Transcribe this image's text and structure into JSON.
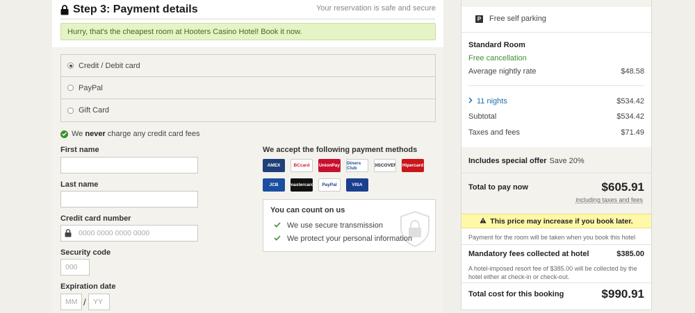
{
  "step": {
    "title": "Step 3: Payment details",
    "secure_note": "Your reservation is safe and secure"
  },
  "hurry_banner": "Hurry, that's the cheapest room at Hooters Casino Hotel! Book it now.",
  "payment_options": [
    {
      "label": "Credit / Debit card",
      "selected": true
    },
    {
      "label": "PayPal",
      "selected": false
    },
    {
      "label": "Gift Card",
      "selected": false
    }
  ],
  "fees_note": {
    "prefix": "We",
    "emphasis": "never",
    "suffix": "charge any credit card fees"
  },
  "form": {
    "first_name_label": "First name",
    "last_name_label": "Last name",
    "cc_label": "Credit card number",
    "cc_placeholder": "0000 0000 0000 0000",
    "security_label": "Security code",
    "security_placeholder": "000",
    "expiration_label": "Expiration date",
    "month_placeholder": "MM",
    "separator": "/",
    "year_placeholder": "YY"
  },
  "methods": {
    "title": "We accept the following payment methods",
    "cards": [
      {
        "name": "AMEX",
        "bg": "#1f3f7a",
        "fg": "#ffffff"
      },
      {
        "name": "BCcard",
        "bg": "#ffffff",
        "fg": "#d21f2b"
      },
      {
        "name": "UnionPay",
        "bg": "#c8102e",
        "fg": "#ffffff"
      },
      {
        "name": "Diners Club",
        "bg": "#ffffff",
        "fg": "#1d4a8c"
      },
      {
        "name": "DISCOVER",
        "bg": "#ffffff",
        "fg": "#222222"
      },
      {
        "name": "Hipercard",
        "bg": "#c9161b",
        "fg": "#ffffff"
      },
      {
        "name": "JCB",
        "bg": "#1b4ea0",
        "fg": "#ffffff"
      },
      {
        "name": "mastercard",
        "bg": "#111111",
        "fg": "#ffffff"
      },
      {
        "name": "PayPal",
        "bg": "#ffffff",
        "fg": "#1a3f8f"
      },
      {
        "name": "VISA",
        "bg": "#1a3f8f",
        "fg": "#ffffff"
      }
    ]
  },
  "trust": {
    "title": "You can count on us",
    "items": [
      "We use secure transmission",
      "We protect your personal information"
    ]
  },
  "summary": {
    "parking": "Free self parking",
    "room": "Standard Room",
    "cancellation": "Free cancellation",
    "avg_rate_label": "Average nightly rate",
    "avg_rate_value": "$48.58",
    "nights_label": "11 nights",
    "nights_value": "$534.42",
    "subtotal_label": "Subtotal",
    "subtotal_value": "$534.42",
    "taxes_label": "Taxes and fees",
    "taxes_value": "$71.49",
    "offer_label": "Includes special offer",
    "offer_value": "Save 20%",
    "total_label": "Total to pay now",
    "total_value": "$605.91",
    "total_note": "including taxes and fees",
    "warning": "This price may increase if you book later.",
    "payment_note": "Payment for the room will be taken when you book this hotel",
    "mandatory_label": "Mandatory fees collected at hotel",
    "mandatory_value": "$385.00",
    "resort_note": "A hotel-imposed resort fee of $385.00 will be collected by the hotel either at check-in or check-out.",
    "booking_total_label": "Total cost for this booking",
    "booking_total_value": "$990.91"
  },
  "colors": {
    "accent_green": "#3f8f2f",
    "link_blue": "#1a6fb0",
    "warning_yellow": "#fff8a8"
  }
}
